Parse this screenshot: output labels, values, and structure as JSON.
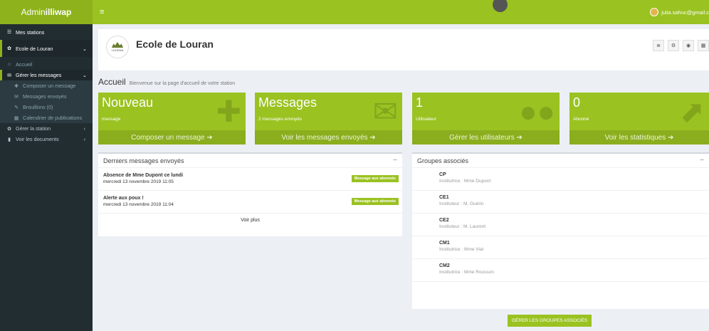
{
  "brand": {
    "prefix": "Admin",
    "bold": "illiwap"
  },
  "topbar": {
    "menu_icon": "≡",
    "user_email": "julia.sahuc@gmail.c"
  },
  "sidebar": {
    "stations": "Mes stations",
    "school": "Ecole de Louran",
    "accueil": "Accueil",
    "gerer_messages": "Gérer les messages",
    "sub": [
      "Composer un message",
      "Messages envoyés",
      "Brouillons (0)",
      "Calendrier de publications"
    ],
    "gerer_station": "Gérer la station",
    "documents": "Voir les documents"
  },
  "header": {
    "school_name": "Ecole de Louran",
    "logo_text": "LOURAN"
  },
  "page": {
    "title": "Accueil",
    "subtitle": "Bienvenue sur la page d'accueil de votre station"
  },
  "stats": [
    {
      "num": "Nouveau",
      "label": "message",
      "footer": "Composer un message ➔"
    },
    {
      "num": "Messages",
      "label": "2 messages envoyés",
      "footer": "Voir les messages envoyés ➔"
    },
    {
      "num": "1",
      "label": "Utilisateur",
      "footer": "Gérer les utilisateurs ➔"
    },
    {
      "num": "0",
      "label": "Abonné",
      "footer": "Voir les statistiques ➔"
    }
  ],
  "messages_panel": {
    "title": "Derniers messages envoyés",
    "items": [
      {
        "title": "Absence de Mme Dupont ce lundi",
        "date": "mercredi 13 novembre 2019 11:05",
        "badge": "Message aux abonnés"
      },
      {
        "title": "Alerte aux poux !",
        "date": "mercredi 13 novembre 2019 11:04",
        "badge": "Message aux abonnés"
      }
    ],
    "more": "Voir plus"
  },
  "groups_panel": {
    "title": "Groupes associés",
    "items": [
      {
        "name": "CP",
        "teacher": "Institutrice : Mme Dupont"
      },
      {
        "name": "CE1",
        "teacher": "Instituteur : M. Guérin"
      },
      {
        "name": "CE2",
        "teacher": "Instituteur : M. Laurent"
      },
      {
        "name": "CM1",
        "teacher": "Institutrice : Mme Vial"
      },
      {
        "name": "CM2",
        "teacher": "Institutrice : Mme Rousson"
      }
    ],
    "button": "GÉRER LES GROUPES ASSOCIÉS"
  },
  "colors": {
    "accent": "#9ac221",
    "sidebar": "#222d32"
  }
}
